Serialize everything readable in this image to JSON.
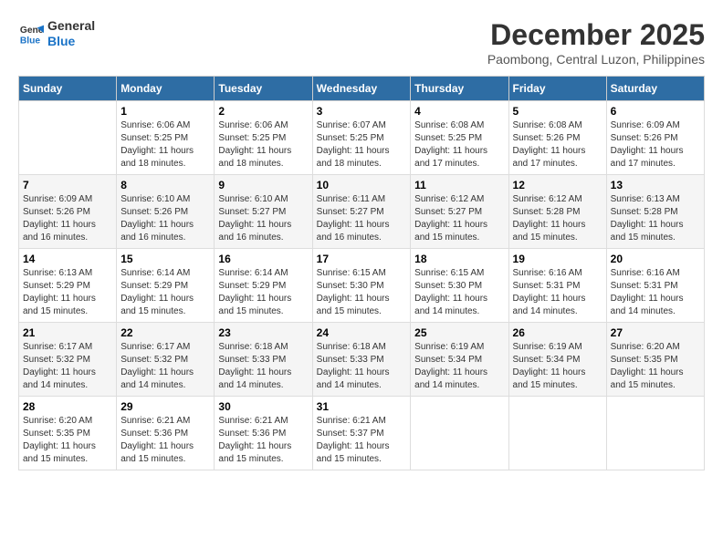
{
  "logo": {
    "line1": "General",
    "line2": "Blue"
  },
  "title": "December 2025",
  "location": "Paombong, Central Luzon, Philippines",
  "weekdays": [
    "Sunday",
    "Monday",
    "Tuesday",
    "Wednesday",
    "Thursday",
    "Friday",
    "Saturday"
  ],
  "weeks": [
    [
      {
        "day": "",
        "info": ""
      },
      {
        "day": "1",
        "info": "Sunrise: 6:06 AM\nSunset: 5:25 PM\nDaylight: 11 hours\nand 18 minutes."
      },
      {
        "day": "2",
        "info": "Sunrise: 6:06 AM\nSunset: 5:25 PM\nDaylight: 11 hours\nand 18 minutes."
      },
      {
        "day": "3",
        "info": "Sunrise: 6:07 AM\nSunset: 5:25 PM\nDaylight: 11 hours\nand 18 minutes."
      },
      {
        "day": "4",
        "info": "Sunrise: 6:08 AM\nSunset: 5:25 PM\nDaylight: 11 hours\nand 17 minutes."
      },
      {
        "day": "5",
        "info": "Sunrise: 6:08 AM\nSunset: 5:26 PM\nDaylight: 11 hours\nand 17 minutes."
      },
      {
        "day": "6",
        "info": "Sunrise: 6:09 AM\nSunset: 5:26 PM\nDaylight: 11 hours\nand 17 minutes."
      }
    ],
    [
      {
        "day": "7",
        "info": "Sunrise: 6:09 AM\nSunset: 5:26 PM\nDaylight: 11 hours\nand 16 minutes."
      },
      {
        "day": "8",
        "info": "Sunrise: 6:10 AM\nSunset: 5:26 PM\nDaylight: 11 hours\nand 16 minutes."
      },
      {
        "day": "9",
        "info": "Sunrise: 6:10 AM\nSunset: 5:27 PM\nDaylight: 11 hours\nand 16 minutes."
      },
      {
        "day": "10",
        "info": "Sunrise: 6:11 AM\nSunset: 5:27 PM\nDaylight: 11 hours\nand 16 minutes."
      },
      {
        "day": "11",
        "info": "Sunrise: 6:12 AM\nSunset: 5:27 PM\nDaylight: 11 hours\nand 15 minutes."
      },
      {
        "day": "12",
        "info": "Sunrise: 6:12 AM\nSunset: 5:28 PM\nDaylight: 11 hours\nand 15 minutes."
      },
      {
        "day": "13",
        "info": "Sunrise: 6:13 AM\nSunset: 5:28 PM\nDaylight: 11 hours\nand 15 minutes."
      }
    ],
    [
      {
        "day": "14",
        "info": "Sunrise: 6:13 AM\nSunset: 5:29 PM\nDaylight: 11 hours\nand 15 minutes."
      },
      {
        "day": "15",
        "info": "Sunrise: 6:14 AM\nSunset: 5:29 PM\nDaylight: 11 hours\nand 15 minutes."
      },
      {
        "day": "16",
        "info": "Sunrise: 6:14 AM\nSunset: 5:29 PM\nDaylight: 11 hours\nand 15 minutes."
      },
      {
        "day": "17",
        "info": "Sunrise: 6:15 AM\nSunset: 5:30 PM\nDaylight: 11 hours\nand 15 minutes."
      },
      {
        "day": "18",
        "info": "Sunrise: 6:15 AM\nSunset: 5:30 PM\nDaylight: 11 hours\nand 14 minutes."
      },
      {
        "day": "19",
        "info": "Sunrise: 6:16 AM\nSunset: 5:31 PM\nDaylight: 11 hours\nand 14 minutes."
      },
      {
        "day": "20",
        "info": "Sunrise: 6:16 AM\nSunset: 5:31 PM\nDaylight: 11 hours\nand 14 minutes."
      }
    ],
    [
      {
        "day": "21",
        "info": "Sunrise: 6:17 AM\nSunset: 5:32 PM\nDaylight: 11 hours\nand 14 minutes."
      },
      {
        "day": "22",
        "info": "Sunrise: 6:17 AM\nSunset: 5:32 PM\nDaylight: 11 hours\nand 14 minutes."
      },
      {
        "day": "23",
        "info": "Sunrise: 6:18 AM\nSunset: 5:33 PM\nDaylight: 11 hours\nand 14 minutes."
      },
      {
        "day": "24",
        "info": "Sunrise: 6:18 AM\nSunset: 5:33 PM\nDaylight: 11 hours\nand 14 minutes."
      },
      {
        "day": "25",
        "info": "Sunrise: 6:19 AM\nSunset: 5:34 PM\nDaylight: 11 hours\nand 14 minutes."
      },
      {
        "day": "26",
        "info": "Sunrise: 6:19 AM\nSunset: 5:34 PM\nDaylight: 11 hours\nand 15 minutes."
      },
      {
        "day": "27",
        "info": "Sunrise: 6:20 AM\nSunset: 5:35 PM\nDaylight: 11 hours\nand 15 minutes."
      }
    ],
    [
      {
        "day": "28",
        "info": "Sunrise: 6:20 AM\nSunset: 5:35 PM\nDaylight: 11 hours\nand 15 minutes."
      },
      {
        "day": "29",
        "info": "Sunrise: 6:21 AM\nSunset: 5:36 PM\nDaylight: 11 hours\nand 15 minutes."
      },
      {
        "day": "30",
        "info": "Sunrise: 6:21 AM\nSunset: 5:36 PM\nDaylight: 11 hours\nand 15 minutes."
      },
      {
        "day": "31",
        "info": "Sunrise: 6:21 AM\nSunset: 5:37 PM\nDaylight: 11 hours\nand 15 minutes."
      },
      {
        "day": "",
        "info": ""
      },
      {
        "day": "",
        "info": ""
      },
      {
        "day": "",
        "info": ""
      }
    ]
  ]
}
